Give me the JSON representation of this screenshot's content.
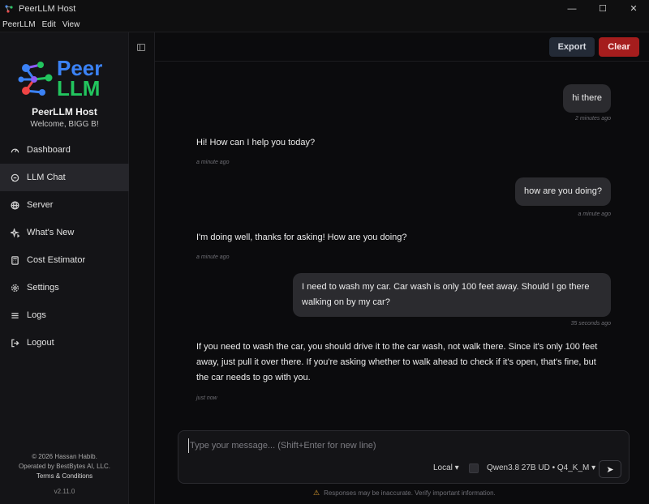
{
  "window": {
    "title": "PeerLLM Host",
    "minimize": "—",
    "maximize": "☐",
    "close": "✕"
  },
  "menu": [
    "PeerLLM",
    "Edit",
    "View"
  ],
  "sidebar": {
    "logo_line1": "Peer",
    "logo_line2": "LLM",
    "host_title": "PeerLLM Host",
    "welcome": "Welcome, BIGG B!",
    "items": [
      {
        "label": "Dashboard",
        "icon": "gauge-icon"
      },
      {
        "label": "LLM Chat",
        "icon": "chat-icon",
        "active": true
      },
      {
        "label": "Server",
        "icon": "globe-icon"
      },
      {
        "label": "What's New",
        "icon": "sparkles-icon"
      },
      {
        "label": "Cost Estimator",
        "icon": "calculator-icon"
      },
      {
        "label": "Settings",
        "icon": "gear-icon"
      },
      {
        "label": "Logs",
        "icon": "list-icon"
      },
      {
        "label": "Logout",
        "icon": "logout-icon"
      }
    ],
    "footer": {
      "copyright": "© 2026 Hassan Habib.",
      "operated": "Operated by BestBytes AI, LLC.",
      "terms": "Terms & Conditions",
      "version": "v2.11.0"
    }
  },
  "toolbar": {
    "export_label": "Export",
    "clear_label": "Clear"
  },
  "messages": [
    {
      "role": "user",
      "text": "hi there",
      "time": "2 minutes ago"
    },
    {
      "role": "assistant",
      "text": "Hi! How can I help you today?",
      "time": "a minute ago"
    },
    {
      "role": "user",
      "text": "how are you doing?",
      "time": "a minute ago"
    },
    {
      "role": "assistant",
      "text": "I'm doing well, thanks for asking! How are you doing?",
      "time": "a minute ago"
    },
    {
      "role": "user",
      "text": "I need to wash my car. Car wash is only 100 feet away. Should I go there walking on by my car?",
      "time": "35 seconds ago"
    },
    {
      "role": "assistant",
      "text": "If you need to wash the car, you should drive it to the car wash, not walk there. Since it's only 100 feet away, just pull it over there. If you're asking whether to walk ahead to check if it's open, that's fine, but the car needs to go with you.",
      "time": "just now"
    }
  ],
  "composer": {
    "placeholder": "Type your message... (Shift+Enter for new line)",
    "source": "Local ▾",
    "model": "Qwen3.8 27B UD • Q4_K_M ▾",
    "send": "➤"
  },
  "disclaimer": "Responses may be inaccurate. Verify important information.",
  "colors": {
    "accent_blue": "#3b82f6",
    "accent_green": "#22c55e",
    "danger": "#a51d1d"
  }
}
